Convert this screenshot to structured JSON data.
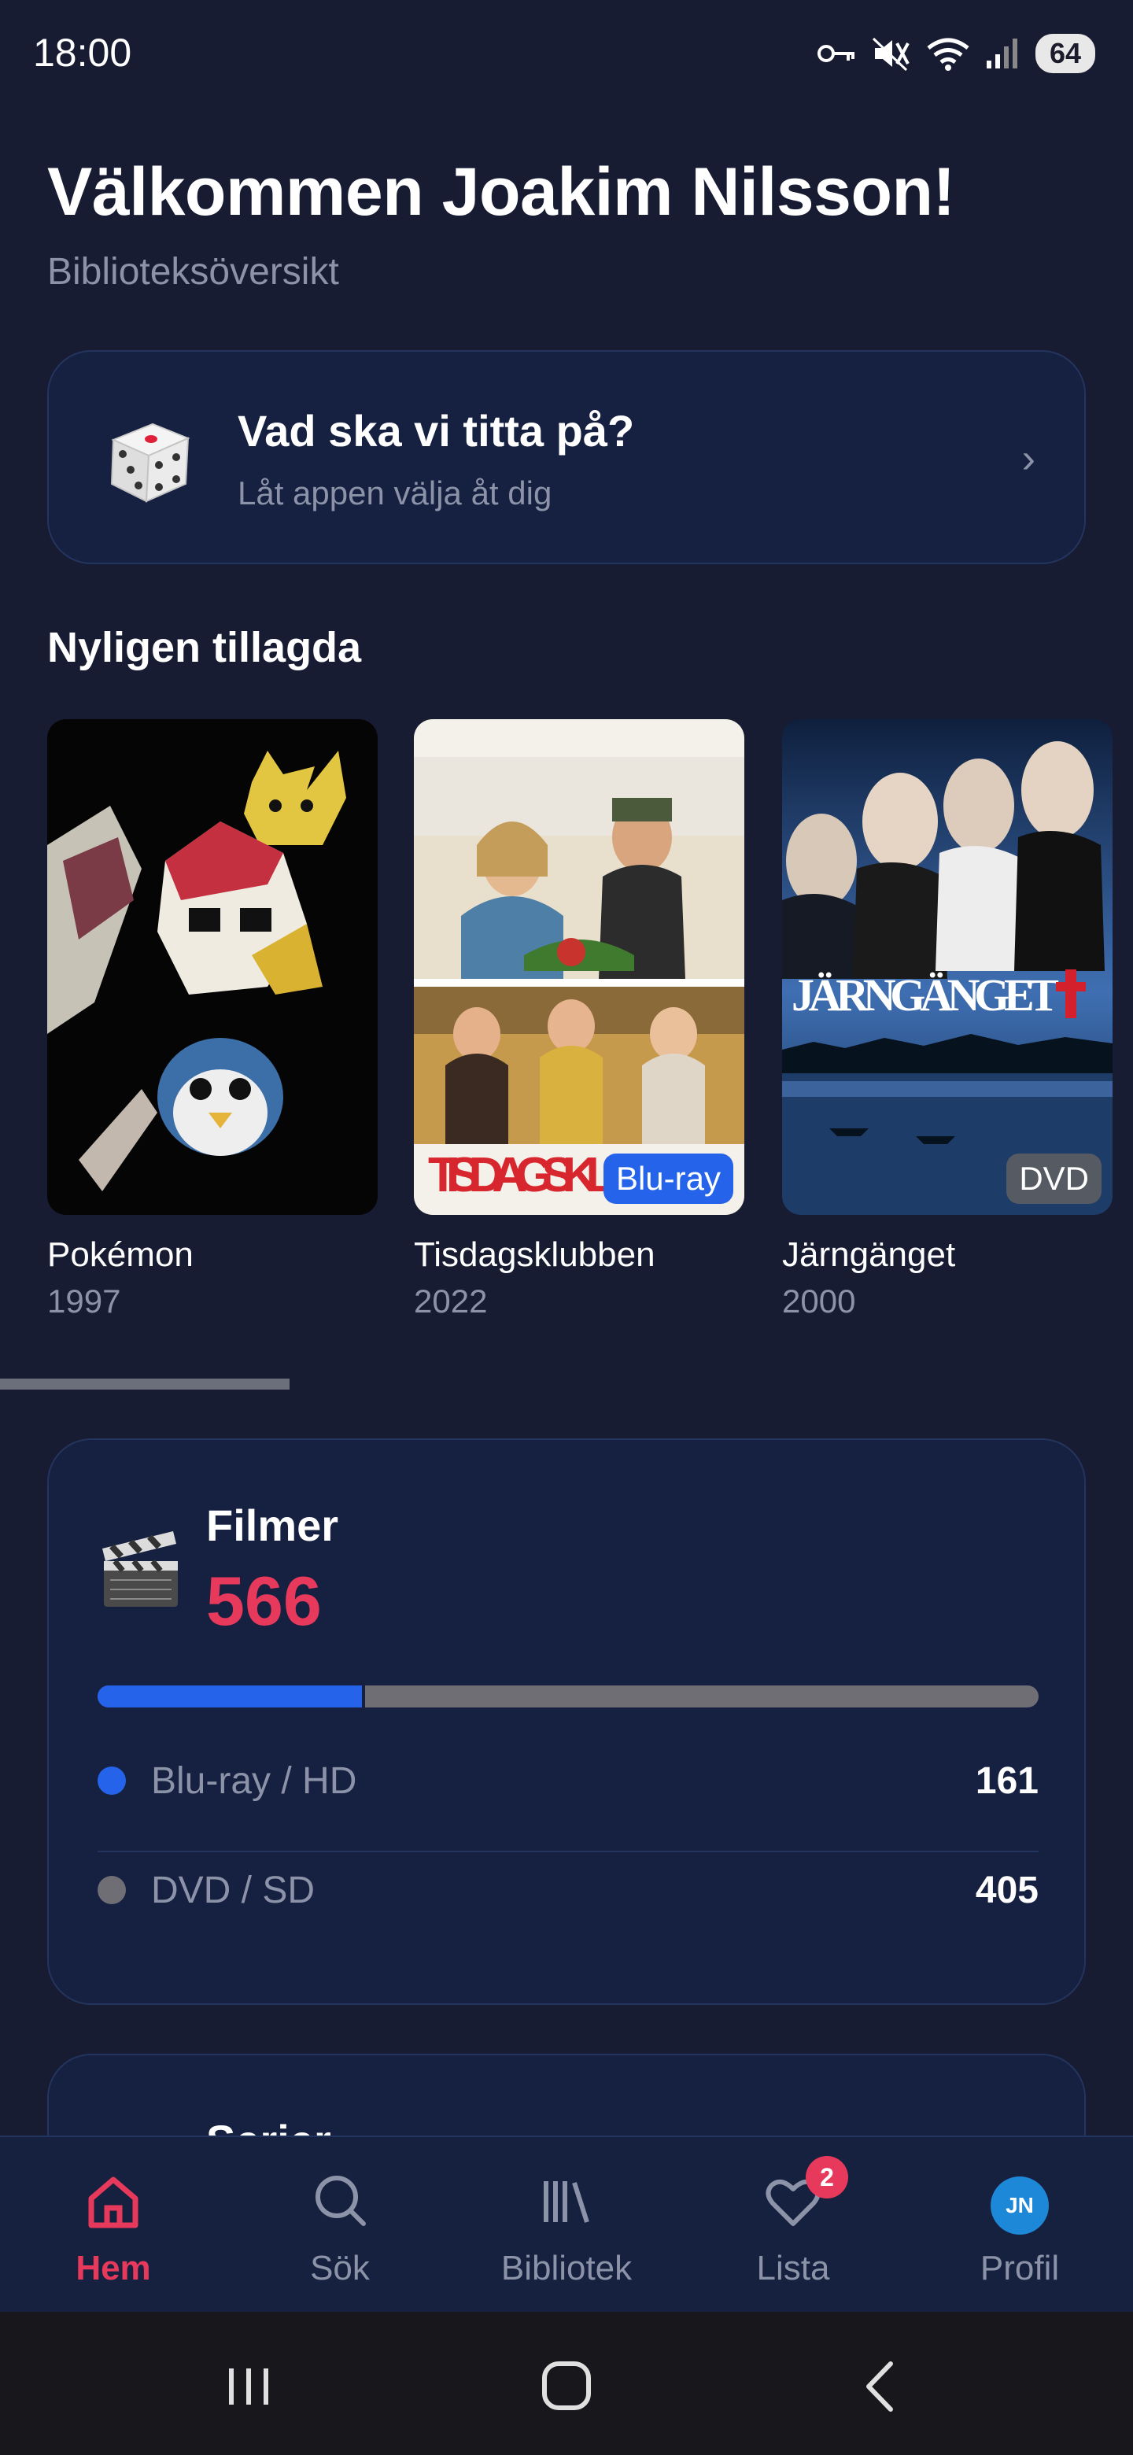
{
  "status_bar": {
    "time": "18:00",
    "battery": "64",
    "icons": [
      "key-icon",
      "mute-icon",
      "wifi-icon",
      "signal-icon"
    ]
  },
  "header": {
    "title": "Välkommen Joakim Nilsson!",
    "subtitle": "Biblioteksöversikt"
  },
  "random_pick": {
    "icon": "dice-icon",
    "title": "Vad ska vi titta på?",
    "subtitle": "Låt appen välja åt dig",
    "chevron": "›"
  },
  "recent": {
    "title": "Nyligen tillagda",
    "items": [
      {
        "title": "Pokémon",
        "year": "1997",
        "badge": ""
      },
      {
        "title": "Tisdagsklubben",
        "year": "2022",
        "badge": "Blu-ray",
        "poster_text": "TISDAGSKLUBBEN"
      },
      {
        "title": "Järngänget",
        "year": "2000",
        "badge": "DVD",
        "poster_text": "JÄRNGÄNGET"
      }
    ],
    "scroll_fraction": 0.26
  },
  "films": {
    "icon": "clapperboard-icon",
    "label": "Filmer",
    "count": "566",
    "bluray_fraction": 0.284,
    "stats": [
      {
        "label": "Blu-ray / HD",
        "value": "161",
        "color": "#2563eb"
      },
      {
        "label": "DVD / SD",
        "value": "405",
        "color": "#6e6e74"
      }
    ]
  },
  "series": {
    "label": "Serier"
  },
  "bottom_nav": {
    "items": [
      {
        "label": "Hem",
        "icon": "home-icon",
        "active": true
      },
      {
        "label": "Sök",
        "icon": "search-icon"
      },
      {
        "label": "Bibliotek",
        "icon": "library-icon"
      },
      {
        "label": "Lista",
        "icon": "heart-icon",
        "badge": "2"
      },
      {
        "label": "Profil",
        "icon": "avatar",
        "initials": "JN"
      }
    ]
  },
  "colors": {
    "background": "#181c33",
    "card": "#162040",
    "accent": "#e6395b",
    "blue": "#2563eb",
    "muted": "#8c93a8"
  }
}
